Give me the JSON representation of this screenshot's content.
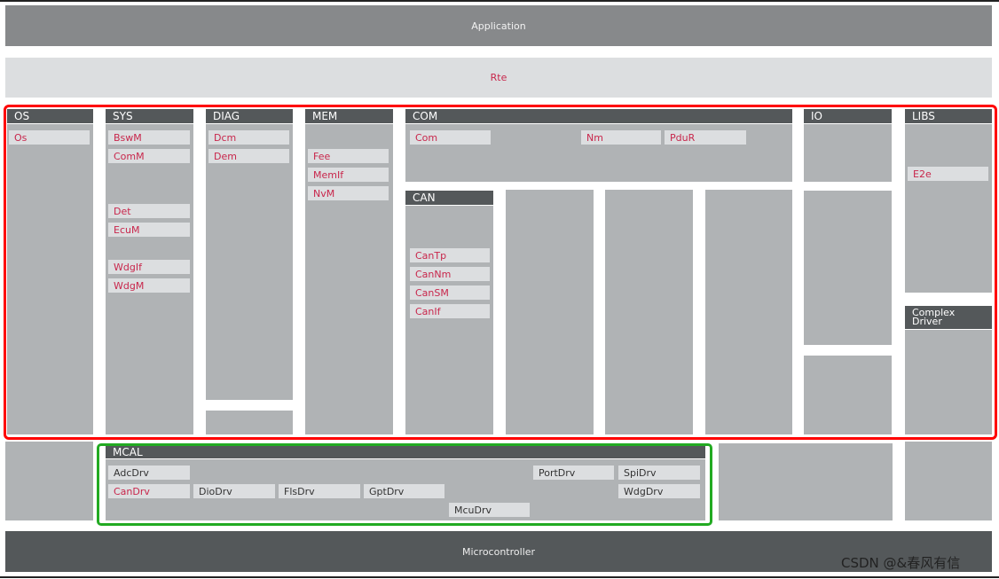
{
  "layers": {
    "application": "Application",
    "rte": "Rte",
    "microcontroller": "Microcontroller"
  },
  "columns": {
    "os": {
      "title": "OS",
      "modules": [
        "Os"
      ]
    },
    "sys": {
      "title": "SYS",
      "modules": [
        "BswM",
        "ComM",
        "Det",
        "EcuM",
        "WdgIf",
        "WdgM"
      ]
    },
    "diag": {
      "title": "DIAG",
      "modules": [
        "Dcm",
        "Dem"
      ]
    },
    "mem": {
      "title": "MEM",
      "modules": [
        "Fee",
        "MemIf",
        "NvM"
      ]
    },
    "com": {
      "title": "COM",
      "modules": [
        "Com",
        "Nm",
        "PduR"
      ]
    },
    "can": {
      "title": "CAN",
      "modules": [
        "CanTp",
        "CanNm",
        "CanSM",
        "CanIf"
      ]
    },
    "io": {
      "title": "IO"
    },
    "libs": {
      "title": "LIBS",
      "modules": [
        "E2e"
      ]
    },
    "complex": {
      "title": "Complex Driver"
    }
  },
  "mcal": {
    "title": "MCAL",
    "modules": [
      "AdcDrv",
      "PortDrv",
      "SpiDrv",
      "CanDrv",
      "DioDrv",
      "FlsDrv",
      "GptDrv",
      "WdgDrv",
      "McuDrv"
    ]
  },
  "watermark": "CSDN @&春风有信",
  "colors": {
    "module_text": "#c8264b",
    "header": "#54585a",
    "highlight_bsw": "#ff0000",
    "highlight_mcal": "#22aa22"
  }
}
